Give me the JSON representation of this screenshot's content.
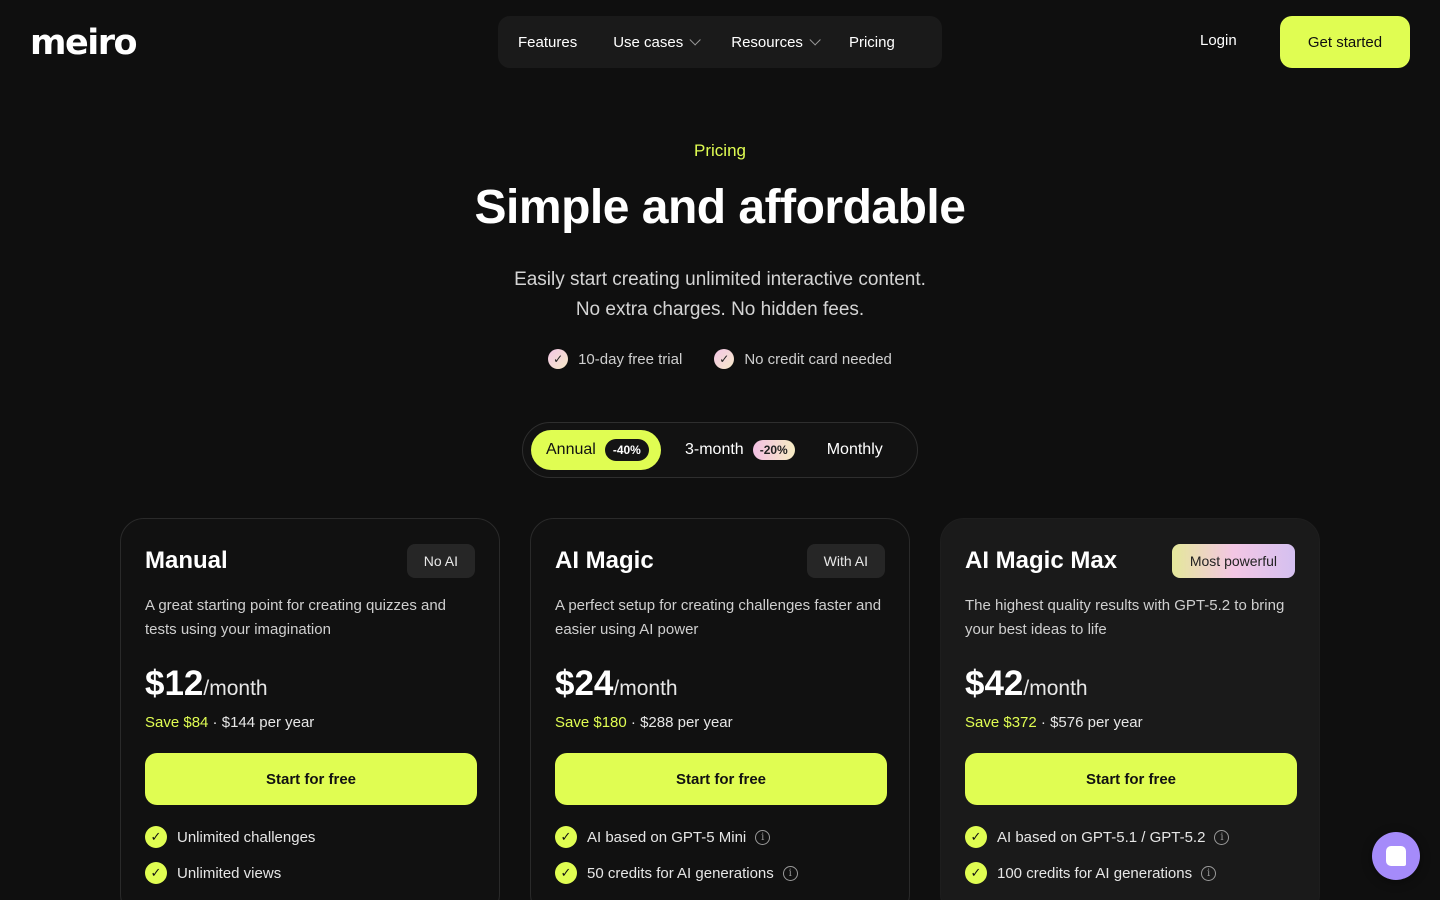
{
  "header": {
    "logo": "meiro",
    "nav": [
      {
        "label": "Features",
        "dropdown": false
      },
      {
        "label": "Use cases",
        "dropdown": true
      },
      {
        "label": "Resources",
        "dropdown": true
      },
      {
        "label": "Pricing",
        "dropdown": false
      }
    ],
    "login": "Login",
    "cta": "Get started"
  },
  "hero": {
    "eyebrow": "Pricing",
    "title": "Simple and affordable",
    "subtitle_1": "Easily start creating unlimited interactive content.",
    "subtitle_2": "No extra charges. No hidden fees.",
    "perks": [
      "10-day free trial",
      "No credit card needed"
    ]
  },
  "billing_toggle": {
    "selected": "Annual",
    "options": [
      {
        "label": "Annual",
        "badge": "-40%"
      },
      {
        "label": "3-month",
        "badge": "-20%"
      },
      {
        "label": "Monthly",
        "badge": ""
      }
    ]
  },
  "plans": [
    {
      "name": "Manual",
      "tag": "No AI",
      "description": "A great starting point for creating quizzes and tests using your imagination",
      "price": "$12",
      "per": "/month",
      "save": "Save $84",
      "yearly": " · $144 per year",
      "cta": "Start for free",
      "features": [
        {
          "text": "Unlimited challenges",
          "info": false
        },
        {
          "text": "Unlimited views",
          "info": false
        }
      ]
    },
    {
      "name": "AI Magic",
      "tag": "With AI",
      "description": "A perfect setup for creating challenges faster and easier using AI power",
      "price": "$24",
      "per": "/month",
      "save": "Save $180",
      "yearly": " · $288 per year",
      "cta": "Start for free",
      "features": [
        {
          "text": "AI based on GPT-5 Mini",
          "info": true
        },
        {
          "text": "50 credits for AI generations",
          "info": true
        }
      ]
    },
    {
      "name": "AI Magic Max",
      "tag": "Most powerful",
      "description": "The highest quality results with GPT-5.2 to bring your best ideas to life",
      "price": "$42",
      "per": "/month",
      "save": "Save $372",
      "yearly": " · $576 per year",
      "cta": "Start for free",
      "features": [
        {
          "text": "AI based on GPT-5.1 / GPT-5.2",
          "info": true
        },
        {
          "text": "100 credits for AI generations",
          "info": true
        }
      ]
    }
  ],
  "icons": {
    "check": "✓",
    "info": "i",
    "chat": "chat-bubble-icon"
  },
  "colors": {
    "accent": "#e0fd52",
    "background": "#0f0f0f",
    "chat": "#a58bfa"
  }
}
